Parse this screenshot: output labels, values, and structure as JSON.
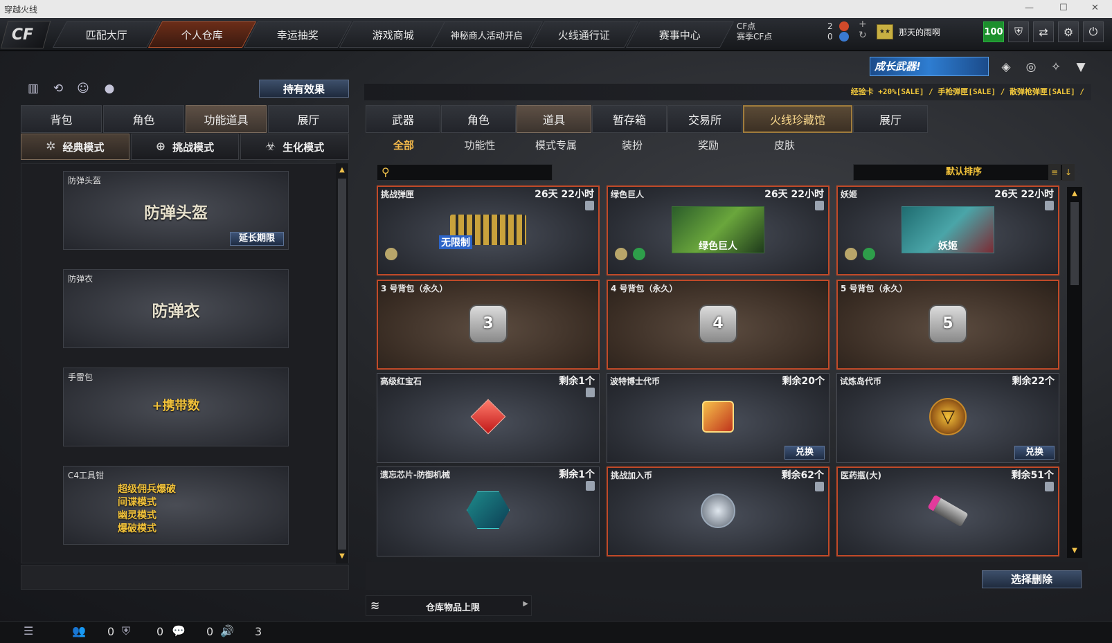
{
  "window": {
    "title": "穿越火线",
    "controls": [
      "—",
      "☐",
      "✕"
    ]
  },
  "logo": "CF",
  "nav": {
    "tabs": [
      "匹配大厅",
      "个人仓库",
      "幸运抽奖",
      "游戏商城",
      "神秘商人活动开启",
      "火线通行证",
      "赛事中心"
    ],
    "active": "个人仓库"
  },
  "points": {
    "cf_label": "CF点",
    "season_label": "赛季CF点",
    "cf_value": "2",
    "season_value": "0"
  },
  "user": {
    "name": "那天的雨啊",
    "level": "100"
  },
  "left": {
    "effects_button": "持有效果",
    "tabs": [
      "背包",
      "角色",
      "功能道具",
      "展厅"
    ],
    "active_tab": "功能道具",
    "modes": [
      "经典模式",
      "挑战模式",
      "生化模式"
    ],
    "active_mode": "经典模式",
    "items": [
      {
        "name": "防弹头盔",
        "art": "防弹头盔",
        "action": "延长期限"
      },
      {
        "name": "防弹衣",
        "art": "防弹衣"
      },
      {
        "name": "手雷包",
        "art": "+携带数"
      },
      {
        "name": "C4工具钳",
        "lines": [
          "超级佣兵爆破",
          "间谍模式",
          "幽灵模式",
          "爆破模式"
        ]
      }
    ]
  },
  "right": {
    "banner": "成长武器!",
    "sale_text": "经验卡 +20%[SALE] / 手枪弹匣[SALE] / 散弹枪弹匣[SALE] /",
    "tabs": [
      "武器",
      "角色",
      "道具",
      "暂存箱",
      "交易所",
      "火线珍藏馆",
      "展厅"
    ],
    "active_tab": "道具",
    "highlight_tab": "火线珍藏馆",
    "subtabs": [
      "全部",
      "功能性",
      "模式专属",
      "装扮",
      "奖励",
      "皮肤"
    ],
    "active_subtab": "全部",
    "search_placeholder": "",
    "sort_label": "默认排序",
    "items": [
      {
        "name": "挑战弹匣",
        "status": "26天 22小时",
        "art": "无限制"
      },
      {
        "name": "绿色巨人",
        "status": "26天 22小时",
        "art": "绿色巨人"
      },
      {
        "name": "妖姬",
        "status": "26天 22小时",
        "art": "妖姬"
      },
      {
        "name": "3 号背包（永久）",
        "status": "",
        "art": "3"
      },
      {
        "name": "4 号背包（永久）",
        "status": "",
        "art": "4"
      },
      {
        "name": "5 号背包（永久）",
        "status": "",
        "art": "5"
      },
      {
        "name": "高级红宝石",
        "status": "剩余1个"
      },
      {
        "name": "波特博士代币",
        "status": "剩余20个",
        "action": "兑换"
      },
      {
        "name": "试炼岛代币",
        "status": "剩余22个",
        "action": "兑换"
      },
      {
        "name": "遗忘芯片-防御机械",
        "status": "剩余1个"
      },
      {
        "name": "挑战加入币",
        "status": "剩余62个"
      },
      {
        "name": "医药瓶(大)",
        "status": "剩余51个"
      }
    ],
    "delete_button": "选择删除",
    "storage_label": "仓库物品上限"
  },
  "status": {
    "friends": "0",
    "clan": "0",
    "chat": "0",
    "volume": "3"
  },
  "colors": {
    "accent": "#f2b84a",
    "active_nav": "#6b2d18",
    "level": "#1c8f2c"
  }
}
